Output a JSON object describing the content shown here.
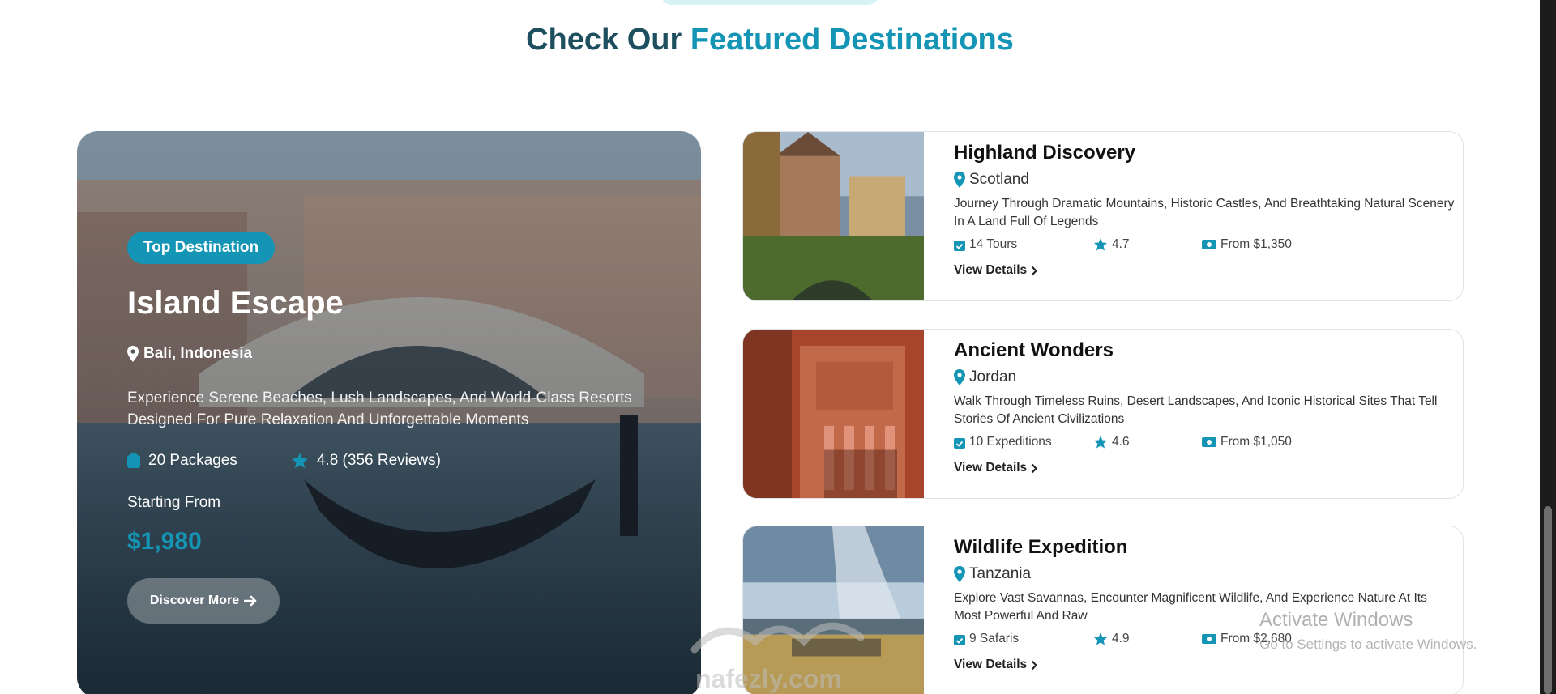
{
  "section": {
    "title_main": "Check Our ",
    "title_accent": "Featured Destinations"
  },
  "featured": {
    "badge": "Top Destination",
    "title": "Island Escape",
    "location": "Bali, Indonesia",
    "description": "Experience Serene Beaches, Lush Landscapes, And World-Class Resorts Designed For Pure Relaxation And Unforgettable Moments",
    "packages": "20 Packages",
    "rating": "4.8 (356 Reviews)",
    "starting_label": "Starting From",
    "price": "$1,980",
    "button": "Discover More",
    "icons": {
      "location": "location-pin-icon",
      "packages": "package-icon",
      "rating": "star-icon",
      "button": "arrow-right-icon"
    }
  },
  "cards": [
    {
      "title": "Highland Discovery",
      "location": "Scotland",
      "description": "Journey Through Dramatic Mountains, Historic Castles, And Breathtaking Natural Scenery In A Land Full Of Legends",
      "count": "14 Tours",
      "rating": "4.7",
      "price": "From $1,350",
      "link": "View Details"
    },
    {
      "title": "Ancient Wonders",
      "location": "Jordan",
      "description": "Walk Through Timeless Ruins, Desert Landscapes, And Iconic Historical Sites That Tell Stories Of Ancient Civilizations",
      "count": "10 Expeditions",
      "rating": "4.6",
      "price": "From $1,050",
      "link": "View Details"
    },
    {
      "title": "Wildlife Expedition",
      "location": "Tanzania",
      "description": "Explore Vast Savannas, Encounter Magnificent Wildlife, And Experience Nature At Its Most Powerful And Raw",
      "count": "9 Safaris",
      "rating": "4.9",
      "price": "From $2,680",
      "link": "View Details"
    }
  ],
  "overlay": {
    "activate_title": "Activate Windows",
    "activate_sub": "Go to Settings to activate Windows.",
    "watermark_site": "nafezly.com"
  },
  "colors": {
    "accent": "#1595b5",
    "title_dark": "#1d4f5e",
    "text_dark": "#111111"
  }
}
